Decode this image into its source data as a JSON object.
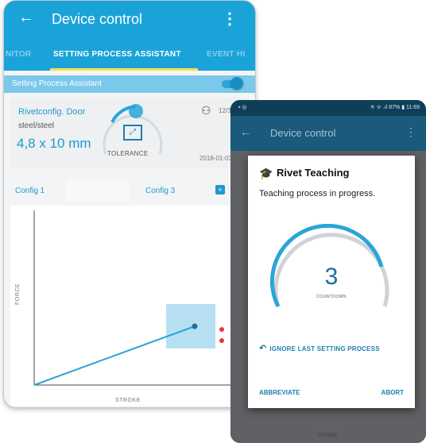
{
  "phone1": {
    "appbar": {
      "back_icon": "arrow-left-icon",
      "title": "Device control",
      "more_icon": "more-vert-icon"
    },
    "tabs": [
      {
        "label": "NITOR",
        "active": false
      },
      {
        "label": "SETTING PROCESS ASSISTANT",
        "active": true
      },
      {
        "label": "EVENT HI",
        "active": false
      }
    ],
    "colors": {
      "accent": "#1aa3d9",
      "indicator": "#ffe24a"
    },
    "assistant": {
      "label": "Setting Process Assistant",
      "enabled": true
    },
    "rivet": {
      "name": "Rivetconfig. Door",
      "material": "steel/steel",
      "size": "4,8 x 10 mm",
      "tolerance_label": "TOLERANCE",
      "count": "12/32",
      "date": "2018-01-03"
    },
    "configs": {
      "first": "Config 1",
      "third": "Config 3",
      "add_icon": "plus-square-icon"
    },
    "chart": {
      "ylabel": "FORCE",
      "xlabel": "STROKE"
    }
  },
  "phone2": {
    "status": {
      "left": "▪ ◎",
      "right": "✕ ᯤ .ıl 87% ▮ 11:69"
    },
    "appbar": {
      "back_icon": "arrow-left-icon",
      "title": "Device control",
      "more_icon": "more-vert-icon"
    },
    "dialog": {
      "icon": "graduation-cap-icon",
      "title": "Rivet Teaching",
      "message": "Teaching process in progress.",
      "count": "3",
      "count_label": "COUNTDOWN",
      "ignore_label": "IGNORE LAST SETTING PROCESS",
      "abbreviate_label": "ABBREVIATE",
      "abort_label": "ABORT"
    },
    "footer": "STROKE"
  }
}
